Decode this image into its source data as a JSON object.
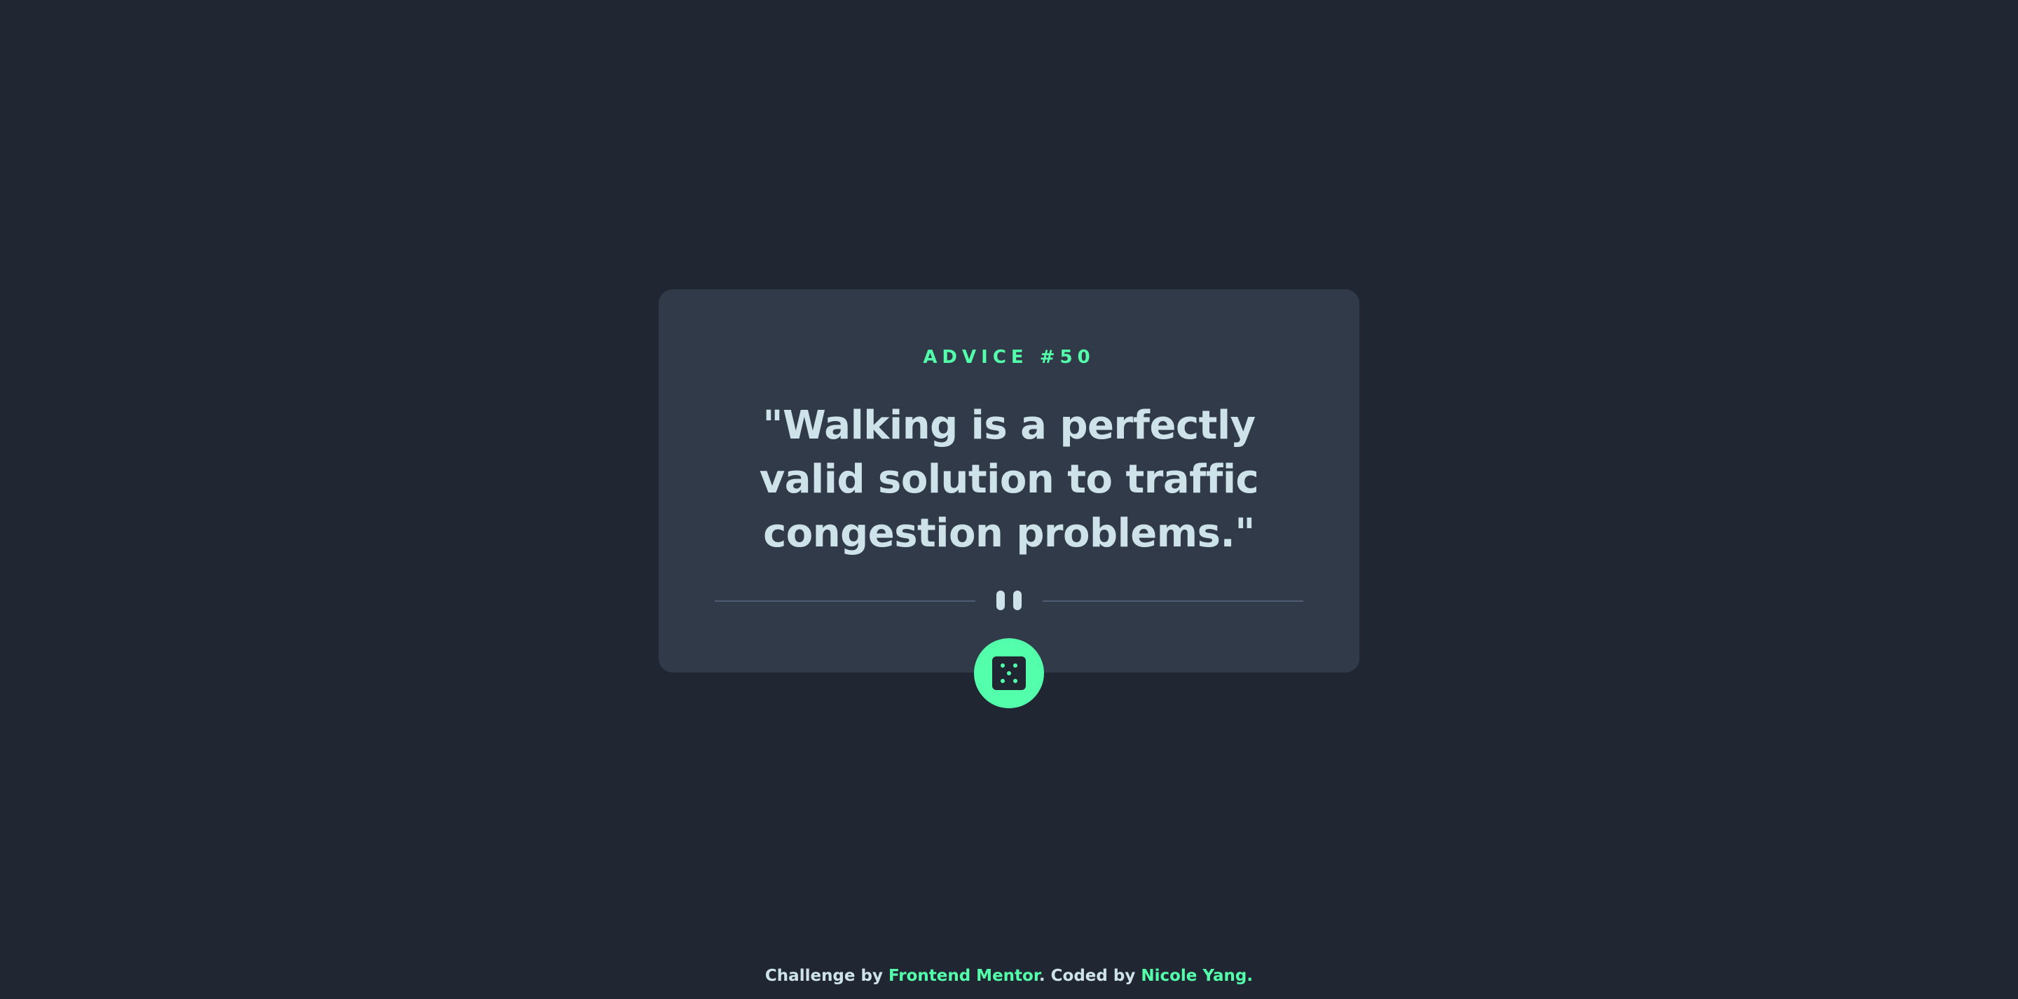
{
  "card": {
    "advice_id": "ADVICE #50",
    "quote": "\"Walking is a perfectly valid solution to traffic congestion problems.\""
  },
  "divider": {
    "icon": "pause-icon"
  },
  "dice_button": {
    "icon": "dice-icon"
  },
  "footer": {
    "prefix": "Challenge by ",
    "challenge_link": "Frontend Mentor",
    "middle": ". Coded by ",
    "author_link": "Nicole Yang",
    "suffix": "."
  },
  "colors": {
    "background": "#202733",
    "card": "#313A48",
    "accent": "#53FFAA",
    "text": "#CEE3E9",
    "divider": "#4F5D74"
  }
}
